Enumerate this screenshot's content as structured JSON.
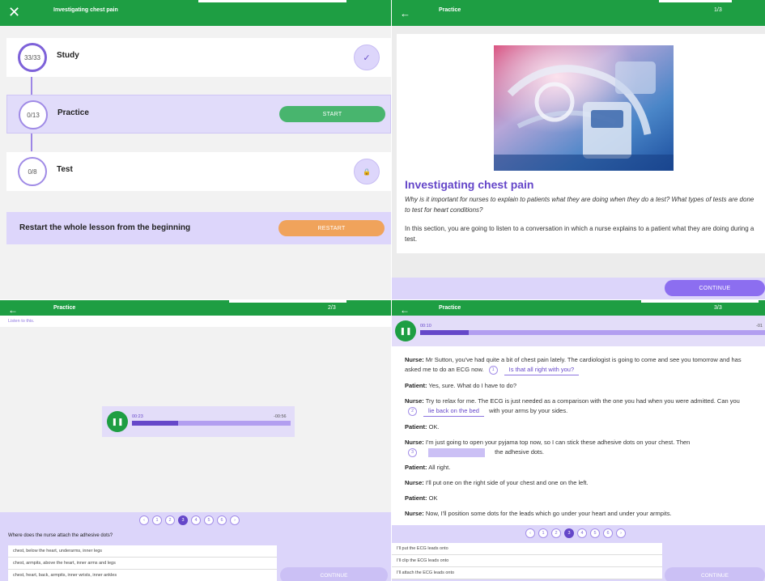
{
  "panel1": {
    "title": "Investigating chest pain",
    "close_glyph": "✕",
    "rows": [
      {
        "count": "33/33",
        "name": "Study",
        "status": "✓"
      },
      {
        "count": "0/13",
        "name": "Practice",
        "action": "START"
      },
      {
        "count": "0/8",
        "name": "Test",
        "status": "🔒"
      }
    ],
    "restart_text": "Restart the whole lesson from the beginning",
    "restart_label": "RESTART",
    "colors": {
      "green": "#1e9e43",
      "purple": "#6547c9",
      "orange": "#f0a35b",
      "start_green": "#48b56e"
    }
  },
  "panel2": {
    "back_glyph": "←",
    "title": "Practice",
    "count": "1/3",
    "heading": "Investigating chest pain",
    "intro_question": "Why is it important for nurses to explain to patients what they are doing when they do a test? What types of tests are done to test for heart conditions?",
    "intro_text": "In this section, you are going to listen to a conversation in which a nurse explains to a patient what they are doing during a test.",
    "continue_label": "CONTINUE"
  },
  "panel3": {
    "back_glyph": "←",
    "title": "Practice",
    "count": "2/3",
    "instruction": "Listen to this.",
    "pause_glyph": "❚❚",
    "audio": {
      "elapsed": "00:23",
      "remaining": "-00:56",
      "progress": 0.29
    },
    "pager": {
      "prev": "‹",
      "next": "›",
      "pages": [
        "1",
        "2",
        "3",
        "4",
        "5",
        "6"
      ],
      "current": 3
    },
    "question": "Where does the nurse attach the adhesive dots?",
    "options": [
      "chest, below the heart, underarms, inner legs",
      "chest, armpits, above the heart, inner arms and legs",
      "chest, heart, back, armpits, inner wrists, inner ankles"
    ],
    "continue_label": "CONTINUE"
  },
  "panel4": {
    "back_glyph": "←",
    "title": "Practice",
    "count": "3/3",
    "pause_glyph": "❚❚",
    "audio": {
      "elapsed": "00:10",
      "remaining": "-01",
      "progress": 0.14
    },
    "speaker_nurse": "Nurse:",
    "speaker_patient": "Patient:",
    "lines": {
      "l1a": "Mr Sutton, you've had quite a bit of chest pain lately. The cardiologist is going to come and see you tomorrow and has asked me to do an ECG now.",
      "gap1_num": "1",
      "gap1_text": "Is that all right with you?",
      "l2": "Yes, sure. What do I have to do?",
      "l3a": "Try to relax for me. The ECG is just needed as a comparison with the one you had when you were admitted. Can you",
      "gap2_num": "2",
      "gap2_text": "lie back on the bed",
      "l3b": "with your arms by your sides.",
      "l4": "OK.",
      "l5a": "I'm just going to open your pyjama top now, so I can stick these adhesive dots on your chest. Then",
      "gap3_num": "3",
      "l5b": "the adhesive dots.",
      "l6": "All right.",
      "l7": "I'll put one on the right side of your chest and one on the left.",
      "l8": "OK",
      "l9": "Now, I'll position some dots for the leads which go under your heart and under your armpits."
    },
    "pager": {
      "prev": "‹",
      "next": "›",
      "pages": [
        "1",
        "2",
        "3",
        "4",
        "5",
        "6"
      ],
      "current": 3
    },
    "options": [
      "I'll put the ECG leads onto",
      "I'll clip the ECG leads onto",
      "I'll attach the ECG leads onto"
    ],
    "continue_label": "CONTINUE"
  }
}
